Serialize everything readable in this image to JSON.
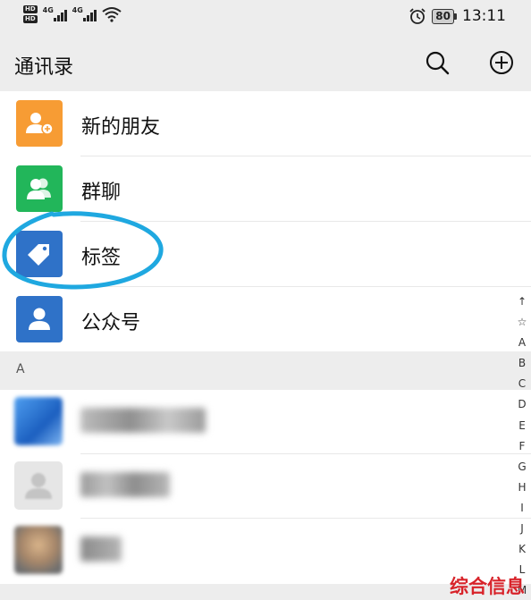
{
  "status_bar": {
    "hd_badges": [
      "HD",
      "HD"
    ],
    "signals": [
      "4G",
      "4G"
    ],
    "battery_level": "80",
    "time": "13:11",
    "icons": [
      "hd-icon",
      "signal-icon",
      "wifi-icon",
      "alarm-icon",
      "battery-icon"
    ]
  },
  "header": {
    "title": "通讯录",
    "icons": [
      "search-icon",
      "add-icon"
    ]
  },
  "fixed_items": [
    {
      "label": "新的朋友",
      "icon": "add-friend-icon",
      "color": "#F79C34"
    },
    {
      "label": "群聊",
      "icon": "group-chat-icon",
      "color": "#22B65A"
    },
    {
      "label": "标签",
      "icon": "tag-icon",
      "color": "#2F72C8"
    },
    {
      "label": "公众号",
      "icon": "official-account-icon",
      "color": "#2F72C8"
    }
  ],
  "section": {
    "letter": "A"
  },
  "contacts": [
    {
      "note": "blurred contact 1"
    },
    {
      "note": "blurred contact 2"
    },
    {
      "note": "blurred contact 3"
    }
  ],
  "index_bar": [
    "↑",
    "☆",
    "A",
    "B",
    "C",
    "D",
    "E",
    "F",
    "G",
    "H",
    "I",
    "J",
    "K",
    "L",
    "M"
  ],
  "annotation": {
    "color": "#1FA8E0"
  },
  "watermark": "综合信息"
}
